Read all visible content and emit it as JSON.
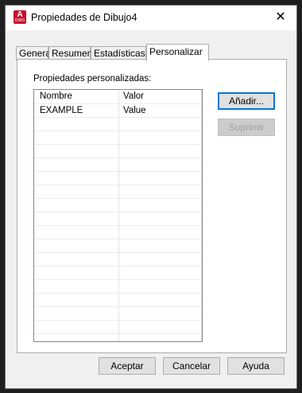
{
  "window": {
    "title": "Propiedades de Dibujo4",
    "app_icon": {
      "letter": "A",
      "sub": "DWG",
      "color": "#c8102e"
    },
    "close_glyph": "✕"
  },
  "tabs": [
    {
      "label": "General",
      "active": false
    },
    {
      "label": "Resumen",
      "active": false
    },
    {
      "label": "Estadísticas",
      "active": false
    },
    {
      "label": "Personalizar",
      "active": true
    }
  ],
  "custom": {
    "section_label": "Propiedades personalizadas:",
    "columns": [
      "Nombre",
      "Valor"
    ],
    "rows": [
      {
        "name": "EXAMPLE",
        "value": "Value"
      }
    ],
    "add_button": "Añadir...",
    "delete_button": "Suprimir"
  },
  "footer": {
    "ok": "Aceptar",
    "cancel": "Cancelar",
    "help": "Ayuda"
  },
  "colors": {
    "focus_border": "#0078d7",
    "dialog_bg": "#f0f0f0"
  }
}
